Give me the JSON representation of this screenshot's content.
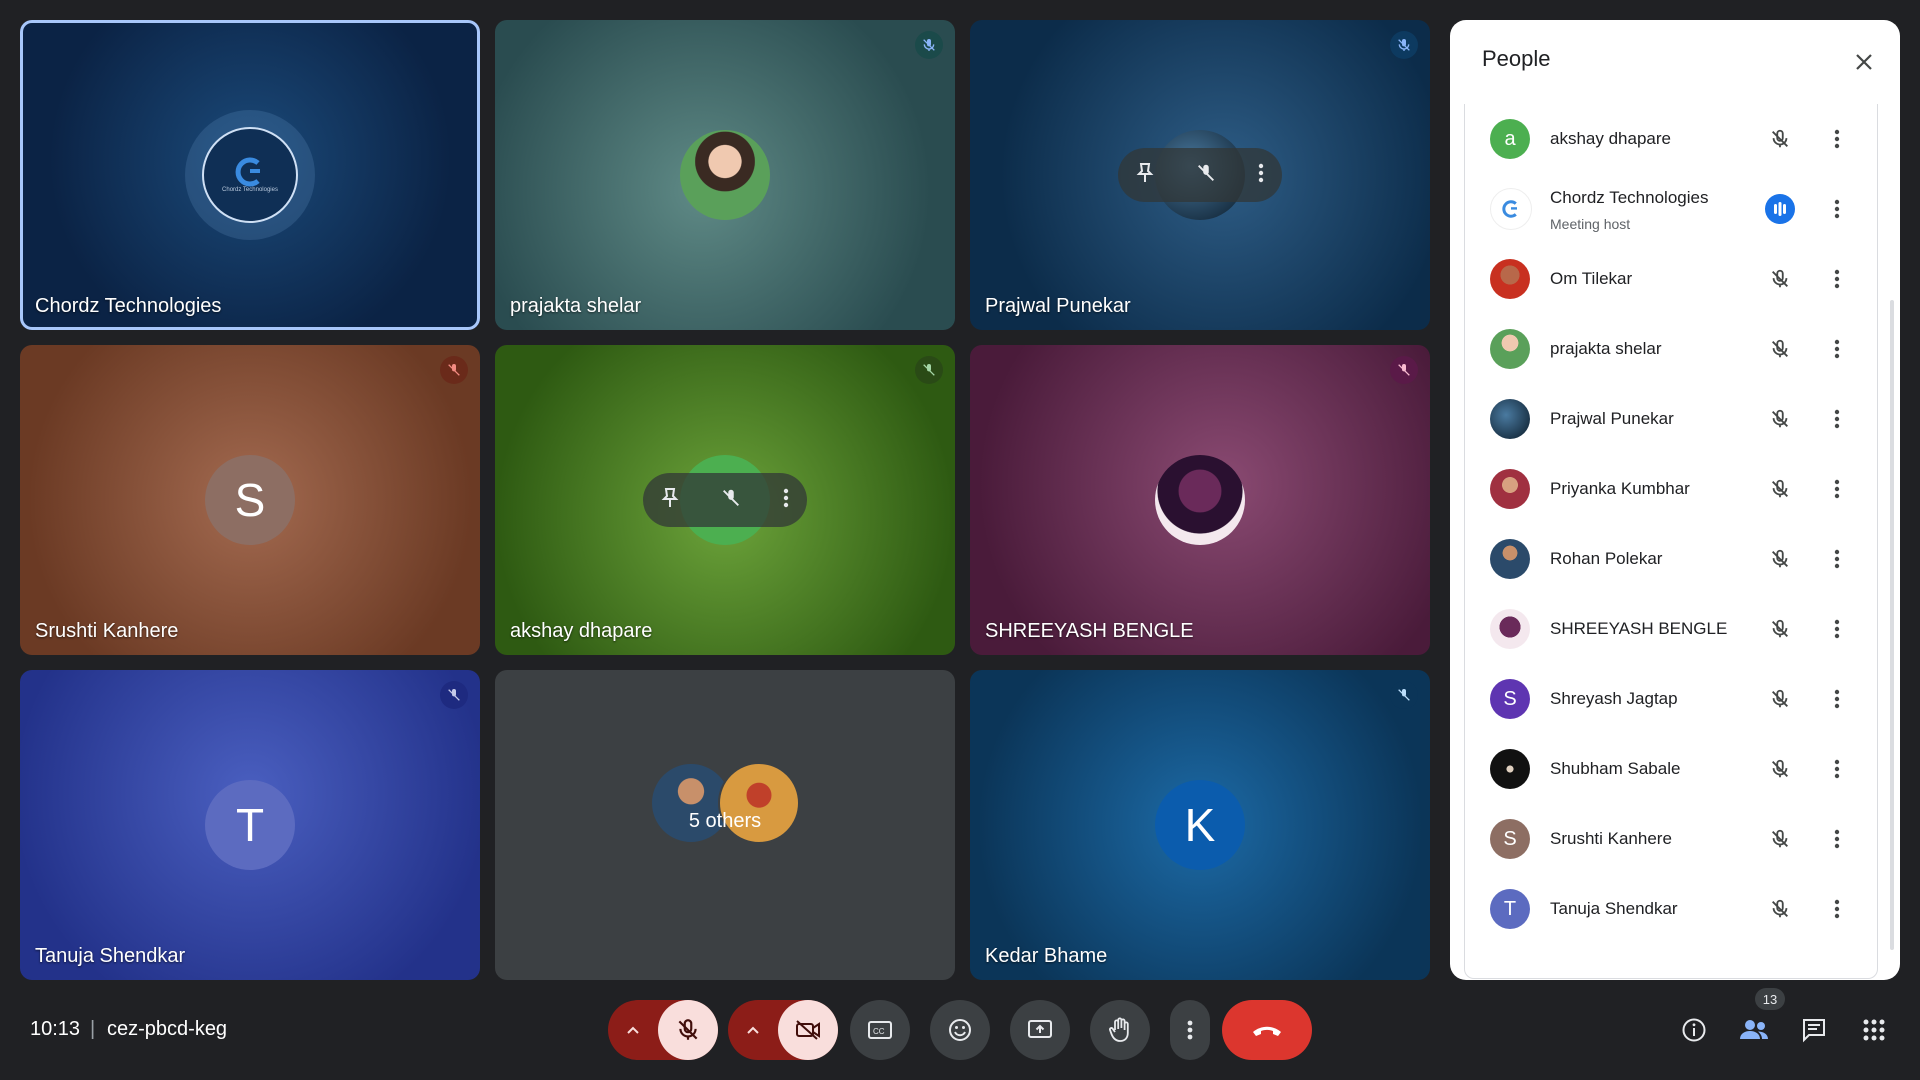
{
  "tiles": [
    {
      "name": "Chordz Technologies",
      "muted": false
    },
    {
      "name": "prajakta shelar",
      "muted": true
    },
    {
      "name": "Prajwal Punekar",
      "muted": true
    },
    {
      "name": "Srushti Kanhere",
      "muted": true,
      "initial": "S"
    },
    {
      "name": "akshay dhapare",
      "muted": true
    },
    {
      "name": "SHREEYASH BENGLE",
      "muted": true
    },
    {
      "name": "Tanuja Shendkar",
      "muted": true,
      "initial": "T"
    },
    {
      "name": "",
      "others_label": "5 others"
    },
    {
      "name": "Kedar Bhame",
      "muted": true,
      "initial": "K"
    }
  ],
  "logo_text": "Chordz Technologies",
  "people_panel": {
    "title": "People",
    "participants": [
      {
        "name": "akshay dhapare",
        "initial": "a",
        "color": "#4caf50"
      },
      {
        "name": "Chordz Technologies",
        "subtitle": "Meeting host",
        "speaking": true
      },
      {
        "name": "Om Tilekar"
      },
      {
        "name": "prajakta shelar"
      },
      {
        "name": "Prajwal Punekar"
      },
      {
        "name": "Priyanka Kumbhar"
      },
      {
        "name": "Rohan Polekar"
      },
      {
        "name": "SHREEYASH BENGLE"
      },
      {
        "name": "Shreyash Jagtap",
        "initial": "S",
        "color": "#5e35b1"
      },
      {
        "name": "Shubham Sabale"
      },
      {
        "name": "Srushti Kanhere",
        "initial": "S",
        "color": "#8d6e63"
      },
      {
        "name": "Tanuja Shendkar",
        "initial": "T",
        "color": "#5c6bc0"
      }
    ]
  },
  "bottom_bar": {
    "time": "10:13",
    "separator": "|",
    "meeting_code": "cez-pbcd-keg",
    "participant_count": "13"
  },
  "colors": {
    "accent_blue": "#a8c7fa",
    "end_call": "#dc362e",
    "muted_control": "#f9dedc"
  }
}
